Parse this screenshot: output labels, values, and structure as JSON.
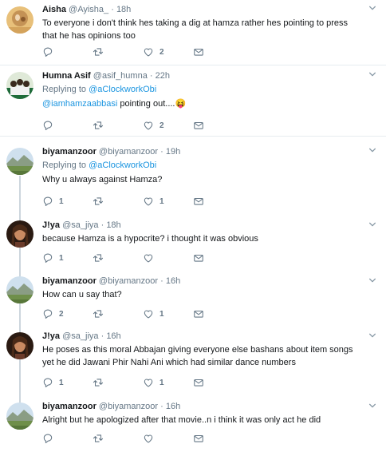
{
  "colors": {
    "link": "#1b95e0",
    "muted": "#657786",
    "line": "#cdd6dd",
    "border": "#e6ecf0"
  },
  "tweets": [
    {
      "name": "Aisha",
      "handle": "@Ayisha_",
      "dot": "·",
      "time": "18h",
      "text": "To everyone i don't  think hes taking a dig at hamza rather hes pointing to press that he has opinions too",
      "counts": {
        "reply": "",
        "retweet": "",
        "like": "2"
      }
    },
    {
      "name": "Humna Asif",
      "handle": "@asif_humna",
      "dot": "·",
      "time": "22h",
      "reply_label": "Replying to",
      "reply_handle": "@aClockworkObi",
      "mention": "@iamhamzaabbasi",
      "text": " pointing out....",
      "emoji": "😝",
      "counts": {
        "reply": "",
        "retweet": "",
        "like": "2"
      }
    },
    {
      "name": "biyamanzoor",
      "handle": "@biyamanzoor",
      "dot": "·",
      "time": "19h",
      "reply_label": "Replying to",
      "reply_handle": "@aClockworkObi",
      "text": "Why u always against Hamza?",
      "counts": {
        "reply": "1",
        "retweet": "",
        "like": "1"
      }
    },
    {
      "name": "J!ya",
      "handle": "@sa_jiya",
      "dot": "·",
      "time": "18h",
      "text": "because Hamza is a hypocrite? i thought it was obvious",
      "counts": {
        "reply": "1",
        "retweet": "",
        "like": ""
      }
    },
    {
      "name": "biyamanzoor",
      "handle": "@biyamanzoor",
      "dot": "·",
      "time": "16h",
      "text": "How can u say that?",
      "counts": {
        "reply": "2",
        "retweet": "",
        "like": "1"
      }
    },
    {
      "name": "J!ya",
      "handle": "@sa_jiya",
      "dot": "·",
      "time": "16h",
      "text": "He poses as this moral Abbajan giving everyone else bashans about item songs yet he did Jawani Phir Nahi Ani which had similar dance numbers",
      "counts": {
        "reply": "1",
        "retweet": "",
        "like": "1"
      }
    },
    {
      "name": "biyamanzoor",
      "handle": "@biyamanzoor",
      "dot": "·",
      "time": "16h",
      "text": "Alright but he apologized after that movie..n i think it was only act he did",
      "counts": {
        "reply": "",
        "retweet": "",
        "like": ""
      }
    }
  ]
}
